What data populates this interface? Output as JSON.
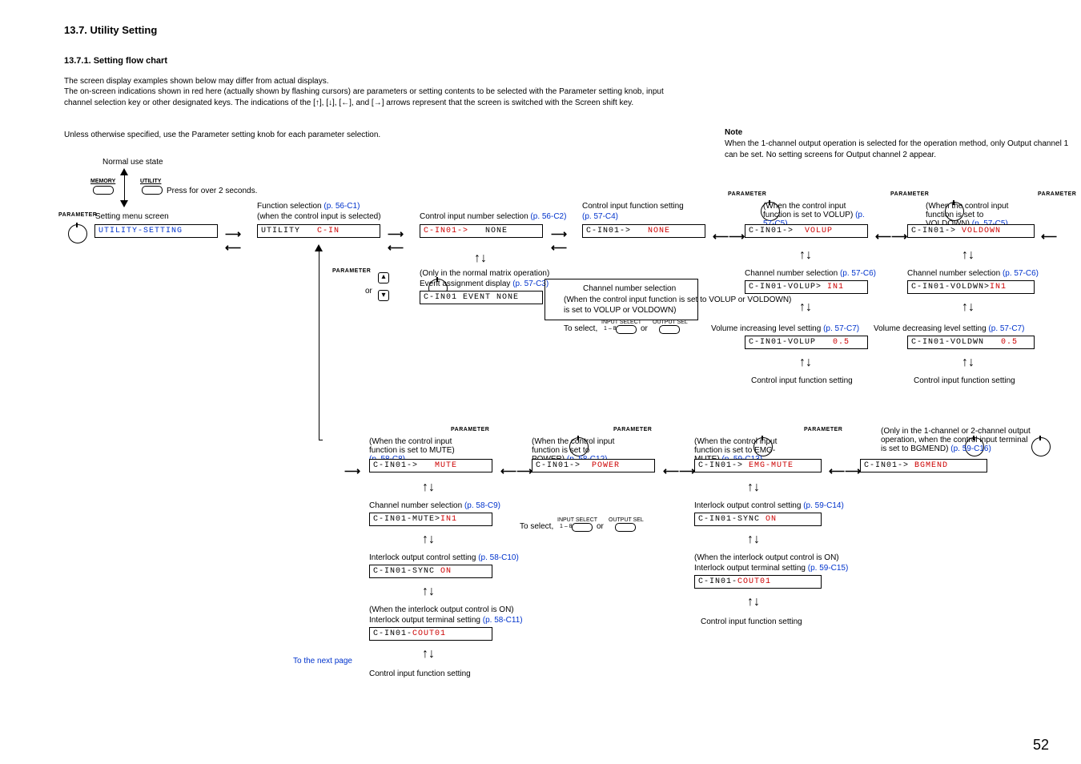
{
  "page_number": "52",
  "section": {
    "title": "13.7. Utility Setting",
    "subtitle": "13.7.1. Setting flow chart",
    "intro_p1": "The screen display examples shown below may differ from actual displays.",
    "intro_p2": "The on-screen indications shown in red here (actually shown by flashing cursors) are parameters or setting contents to be selected with the Parameter setting knob, input channel selection key or other designated keys. The indications of the [↑], [↓], [←], and [→] arrows represent that the screen is switched with the Screen shift key.",
    "intro_p3": "Unless otherwise specified, use the Parameter setting knob for each parameter selection.",
    "note_title": "Note",
    "note_body": "When the 1-channel output operation is selected for the operation method, only Output channel 1 can be set. No setting screens for Output channel 2 appear."
  },
  "labels": {
    "normal_use": "Normal use state",
    "memory": "MEMORY",
    "utility": "UTILITY",
    "press2s": "Press for over 2 seconds.",
    "parameter": "PARAMETER",
    "setting_menu": "Setting menu screen",
    "func_sel": "Function selection",
    "func_sel_ref": "(p. 56-C1)",
    "func_sel_when": "(when the control input is selected)",
    "cin_num_sel": "Control input number selection",
    "cin_num_sel_ref": "(p. 56-C2)",
    "cin_func": "Control input function setting",
    "cin_func_ref": "(p. 57-C4)",
    "volup_when": "(When the control input function is set to VOLUP)",
    "volup_ref": "(p. 57-C5)",
    "voldown_when": "(When the control input function is set to VOLDOWN)",
    "voldown_ref": "(p. 57-C5)",
    "matrix_only": "(Only in the normal matrix operation)",
    "event_disp": "Event assignment display",
    "event_disp_ref": "(p. 57-C3)",
    "chnum_sel": "Channel number selection",
    "chnum_when_volup": "(When the control input function is set to VOLUP or VOLDOWN)",
    "to_select": "To select,",
    "input_select": "INPUT SELECT",
    "input_1_8": "1 – 8",
    "output_sel": "OUTPUT SEL",
    "or": "or",
    "chnum_ref_c6": "(p. 57-C6)",
    "volup_lvl": "Volume increasing level setting",
    "volup_lvl_ref": "(p. 57-C7)",
    "voldown_lvl": "Volume decreasing level setting",
    "voldown_lvl_ref": "(p. 57-C7)",
    "cin_func2": "Control input function setting",
    "mute_when": "(When the control input function is set to MUTE)",
    "mute_ref": "(p. 58-C8)",
    "power_when": "(When the control input function is set to POWER)",
    "power_ref": "(p. 58-C12)",
    "emg_when": "(When the control input function is set to EMG-MUTE)",
    "emg_ref": "(p. 59-C13)",
    "bgmend_only": "(Only in the 1-channel or 2-channel output operation, when the control input terminal is set to BGMEND)",
    "bgmend_ref": "(p. 59-C16)",
    "chnum_ref_c9": "(p. 58-C9)",
    "interlock_out": "Interlock output control setting",
    "interlock_ref_c10": "(p. 58-C10)",
    "interlock_ref_c14": "(p. 59-C14)",
    "interlock_when": "(When the interlock output control is ON)",
    "interlock_term": "Interlock output terminal setting",
    "interlock_term_ref_c11": "(p. 58-C11)",
    "interlock_term_ref_c15": "(p. 59-C15)",
    "to_next": "To the next page"
  },
  "screens": {
    "utility_setting": "UTILITY-SETTING",
    "utility_cin_a": "UTILITY   ",
    "utility_cin_b": "C-IN",
    "cin01_arrow": "C-IN01->",
    "none": "NONE",
    "volup": "VOLUP",
    "voldown": "VOLDOWN",
    "event_none": "C-IN01 EVENT NONE",
    "volup_in1_a": "C-IN01-VOLUP>",
    "volup_in1_b": "IN1",
    "voldwn_in1_a": "C-IN01-VOLDWN>",
    "voldwn_in1_b": "IN1",
    "volup_05_a": "C-IN01-VOLUP",
    "val_05": "0.5",
    "voldwn_05_a": "C-IN01-VOLDWN",
    "mute": "MUTE",
    "power": "POWER",
    "emgmute": "EMG-MUTE",
    "bgmend": "BGMEND",
    "mute_in1_a": "C-IN01-MUTE>",
    "mute_in1_b": "IN1",
    "sync_on_a": "C-IN01-SYNC ",
    "sync_on_b": "ON",
    "cout01_a": "C-IN01-",
    "cout01_b": "COUT01"
  }
}
